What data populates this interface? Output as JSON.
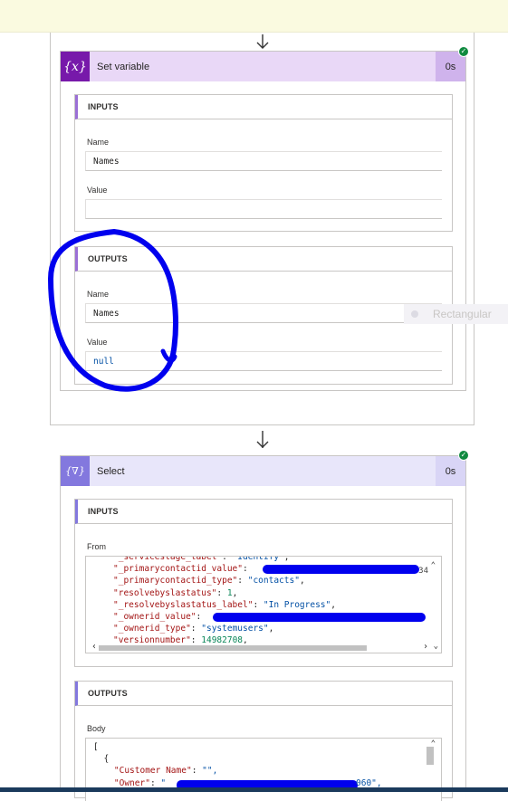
{
  "colors": {
    "banner": "#fafae0",
    "set_variable_header": "#e9d8f7",
    "set_variable_icon": "#7719aa",
    "set_variable_duration_bg": "#cfb3ec",
    "select_header": "#e8e6fa",
    "select_icon": "#8378de",
    "select_duration_bg": "#d9d5f6",
    "success": "#0f8a3f",
    "annotation": "#0000ee"
  },
  "set_variable": {
    "icon": "variable-icon",
    "icon_text": "{x}",
    "title": "Set variable",
    "duration": "0s",
    "status_icon": "success-check-icon",
    "inputs": {
      "heading": "INPUTS",
      "name_label": "Name",
      "name_value": "Names",
      "value_label": "Value",
      "value_value": ""
    },
    "outputs": {
      "heading": "OUTPUTS",
      "name_label": "Name",
      "name_value": "Names",
      "value_label": "Value",
      "value_value": "null"
    }
  },
  "ghost_tooltip": {
    "text": "Rectangular"
  },
  "select": {
    "icon": "select-icon",
    "icon_text": "{∇}",
    "title": "Select",
    "duration": "0s",
    "status_icon": "success-check-icon",
    "inputs": {
      "heading": "INPUTS",
      "from_label": "From",
      "from_lines": [
        [
          "\"_servicestage_label\"",
          ": ",
          "\"Identify\"",
          ","
        ],
        [
          "\"_primarycontactid_value\"",
          ": ",
          "",
          ""
        ],
        [
          "\"_primarycontactid_type\"",
          ": ",
          "\"contacts\"",
          ","
        ],
        [
          "\"resolvebyslastatus\"",
          ": ",
          "1",
          ","
        ],
        [
          "\"_resolvebyslastatus_label\"",
          ": ",
          "\"In Progress\"",
          ","
        ],
        [
          "\"_ownerid_value\"",
          ": ",
          "",
          ""
        ],
        [
          "\"_ownerid_type\"",
          ": ",
          "\"systemusers\"",
          ","
        ],
        [
          "\"versionnumber\"",
          ": ",
          "14982708",
          ","
        ]
      ],
      "from_trailing_fragment": "34"
    },
    "outputs": {
      "heading": "OUTPUTS",
      "body_label": "Body",
      "body_lines": [
        "[",
        "  {",
        "    \"Customer Name\": \"\",",
        "    \"Owner\": \""
      ],
      "owner_tail": "060\","
    }
  }
}
